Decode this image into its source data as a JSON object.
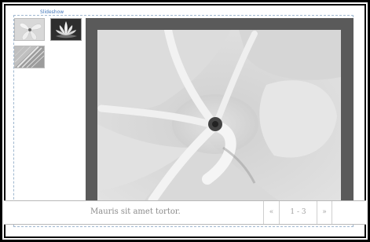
{
  "module": {
    "title": "Slideshow"
  },
  "thumbnails": [
    {
      "name": "frangipani-thumbnail"
    },
    {
      "name": "lotus-thumbnail"
    },
    {
      "name": "leaf-thumbnail"
    }
  ],
  "slide": {
    "caption": "Mauris sit amet tortor.",
    "counter": "1 - 3"
  },
  "controls": {
    "prev_glyph": "«",
    "next_glyph": "»"
  },
  "colors": {
    "viewer_background": "#5a5a5a",
    "title_link": "#3f74b8",
    "caption_text": "#8a8a8a"
  }
}
